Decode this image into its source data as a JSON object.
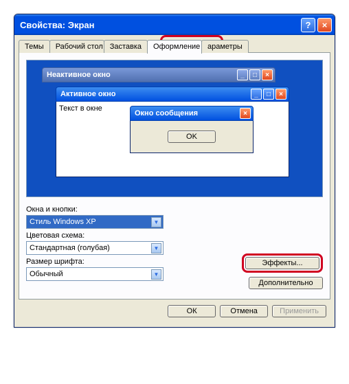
{
  "window": {
    "title": "Свойства: Экран"
  },
  "tabs": [
    {
      "label": "Темы"
    },
    {
      "label": "Рабочий стол"
    },
    {
      "label": "Заставка"
    },
    {
      "label": "Оформление"
    },
    {
      "label": "араметры"
    }
  ],
  "preview": {
    "inactive_title": "Неактивное окно",
    "active_title": "Активное окно",
    "body_text": "Текст в окне",
    "msgbox_title": "Окно сообщения",
    "msgbox_ok": "OK"
  },
  "form": {
    "windows_buttons_label": "Окна и кнопки:",
    "windows_buttons_value": "Стиль Windows XP",
    "color_scheme_label": "Цветовая схема:",
    "color_scheme_value": "Стандартная (голубая)",
    "font_size_label": "Размер шрифта:",
    "font_size_value": "Обычный",
    "effects_button": "Эффекты...",
    "advanced_button": "Дополнительно"
  },
  "dialog": {
    "ok": "ОК",
    "cancel": "Отмена",
    "apply": "Применить"
  }
}
